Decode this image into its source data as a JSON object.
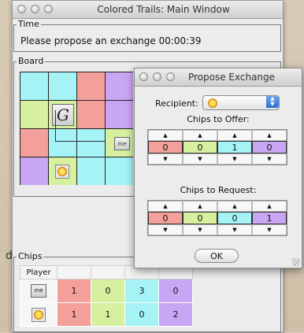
{
  "main_window": {
    "title": "Colored Trails: Main Window"
  },
  "time": {
    "label": "Time",
    "text": "Please propose an exchange 00:00:39"
  },
  "board": {
    "label": "Board",
    "colors": {
      "red": "#f4a09a",
      "green": "#d6f0a0",
      "cyan": "#a6f3f6",
      "purple": "#c9a6f3"
    },
    "grid": [
      [
        "cyan",
        "cyan",
        "red",
        "purple"
      ],
      [
        "green",
        "green",
        "red",
        "purple"
      ],
      [
        "red",
        "cyan",
        "cyan",
        "green"
      ],
      [
        "purple",
        "green",
        "cyan",
        "cyan"
      ]
    ],
    "goal_letter": "G",
    "me_label": "me"
  },
  "chips": {
    "label": "Chips",
    "header": [
      "Player",
      "",
      "",
      "",
      ""
    ],
    "rows": [
      {
        "player": "me",
        "values": [
          "1",
          "0",
          "3",
          "0"
        ]
      },
      {
        "player": "sun-icon",
        "values": [
          "1",
          "1",
          "0",
          "2"
        ]
      }
    ]
  },
  "dialog": {
    "title": "Propose Exchange",
    "recipient_label": "Recipient:",
    "offer_label": "Chips to Offer:",
    "offer_values": [
      "0",
      "0",
      "1",
      "0"
    ],
    "request_label": "Chips to Request:",
    "request_values": [
      "0",
      "0",
      "0",
      "1"
    ],
    "ok_label": "OK"
  },
  "stray_char": "d"
}
